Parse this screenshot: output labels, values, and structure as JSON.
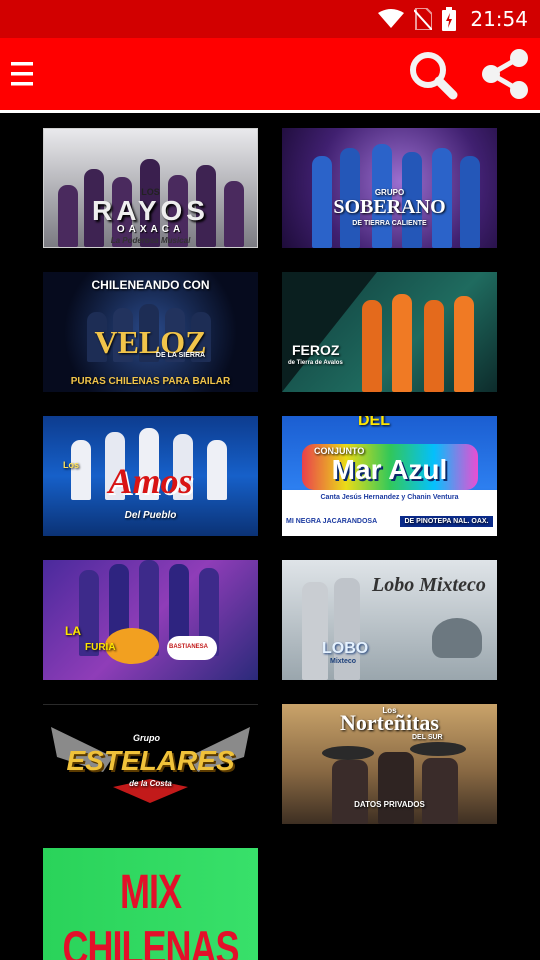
{
  "status": {
    "time": "21:54"
  },
  "toolbar": {
    "menu_icon": "menu-icon",
    "search_icon": "search-icon",
    "share_icon": "share-icon"
  },
  "tiles": [
    {
      "t1": "LOS",
      "t2": "RAYOS",
      "t3": "OAXACA",
      "t4": "La Poderosa Musical"
    },
    {
      "t1": "GRUPO",
      "t2": "SOBERANO",
      "t3": "DE TIERRA CALIENTE"
    },
    {
      "t1": "CHILENEANDO CON",
      "t2": "VELOZ",
      "t3": "DE LA SIERRA",
      "t4": "PURAS CHILENAS PARA BAILAR"
    },
    {
      "t1": "FEROZ",
      "t2": "de Tierra de Avalos"
    },
    {
      "t1": "Los",
      "t2": "Amos",
      "t3": "Del Pueblo"
    },
    {
      "t1": "DEL",
      "t2": "CONJUNTO",
      "t3": "Mar Azul",
      "t4": "Canta Jesús Hernandez y Chanin Ventura",
      "t5": "MI NEGRA JACARANDOSA",
      "t6": "DE PINOTEPA NAL. OAX."
    },
    {
      "t1": "LA",
      "t2": "FURIA",
      "t3": "BASTIANESA"
    },
    {
      "t1": "Lobo Mixteco",
      "t2": "LOBO",
      "t3": "Mixteco"
    },
    {
      "t1": "Grupo",
      "t2": "ESTELARES",
      "t3": "de la Costa"
    },
    {
      "t1": "Los",
      "t2": "Norteñitas",
      "t3": "DEL SUR",
      "t4": "DATOS PRIVADOS"
    },
    {
      "t1": "MIX CHILENAS"
    }
  ]
}
